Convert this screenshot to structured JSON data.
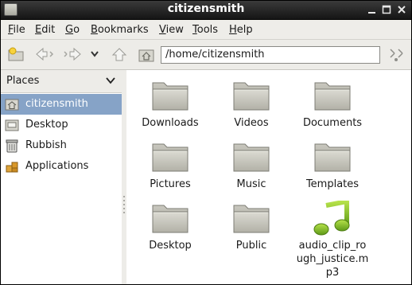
{
  "window": {
    "title": "citizensmith"
  },
  "menu": {
    "items": [
      {
        "label": "File"
      },
      {
        "label": "Edit"
      },
      {
        "label": "Go"
      },
      {
        "label": "Bookmarks"
      },
      {
        "label": "View"
      },
      {
        "label": "Tools"
      },
      {
        "label": "Help"
      }
    ]
  },
  "location": {
    "path": "/home/citizensmith"
  },
  "sidebar": {
    "header": "Places",
    "items": [
      {
        "label": "citizensmith",
        "icon": "home-folder-icon",
        "selected": true
      },
      {
        "label": "Desktop",
        "icon": "desktop-icon",
        "selected": false
      },
      {
        "label": "Rubbish",
        "icon": "trash-icon",
        "selected": false
      },
      {
        "label": "Applications",
        "icon": "applications-icon",
        "selected": false
      }
    ]
  },
  "files": [
    {
      "label": "Downloads",
      "icon": "folder-icon"
    },
    {
      "label": "Videos",
      "icon": "folder-icon"
    },
    {
      "label": "Documents",
      "icon": "folder-icon"
    },
    {
      "label": "Pictures",
      "icon": "folder-icon"
    },
    {
      "label": "Music",
      "icon": "folder-icon"
    },
    {
      "label": "Templates",
      "icon": "folder-icon"
    },
    {
      "label": "Desktop",
      "icon": "folder-icon"
    },
    {
      "label": "Public",
      "icon": "folder-icon"
    },
    {
      "label": "audio_clip_rough_justice.mp3",
      "icon": "music-note-icon"
    }
  ],
  "colors": {
    "selection": "#86a3c7",
    "titlebar": "#1e1e1e",
    "folder": "#b9b8ad",
    "audio": "#7cb928"
  }
}
